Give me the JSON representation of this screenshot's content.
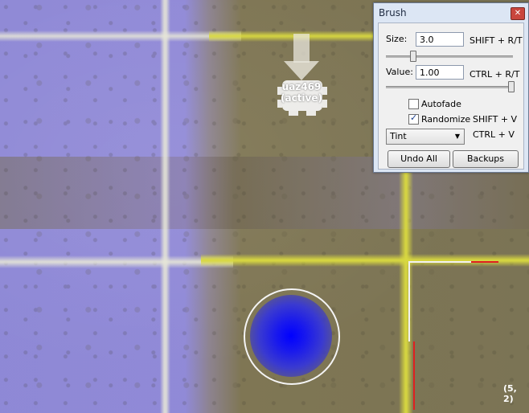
{
  "scene": {
    "unit": {
      "name": "uaz469",
      "status": "(active)"
    },
    "coordinates": "(5, 2)"
  },
  "brush_window": {
    "title": "Brush",
    "size": {
      "label": "Size:",
      "value": "3.0",
      "shortcut": "SHIFT + R/T",
      "slider_level": 0.2
    },
    "value": {
      "label": "Value:",
      "value": "1.00",
      "shortcut": "CTRL + R/T",
      "slider_level": 1.0
    },
    "autofade": {
      "label": "Autofade",
      "checked": false
    },
    "randomize": {
      "label": "Randomize",
      "checked": true,
      "shortcut": "SHIFT + V"
    },
    "mode": {
      "selected": "Tint",
      "shortcut": "CTRL + V"
    },
    "buttons": {
      "undo_all": "Undo All",
      "backups": "Backups"
    }
  },
  "colors": {
    "brush_core": "#0000ff",
    "brush_ring": "#f4f4f4",
    "highlight_line": "#d8d840",
    "selection_line": "#e02020"
  }
}
